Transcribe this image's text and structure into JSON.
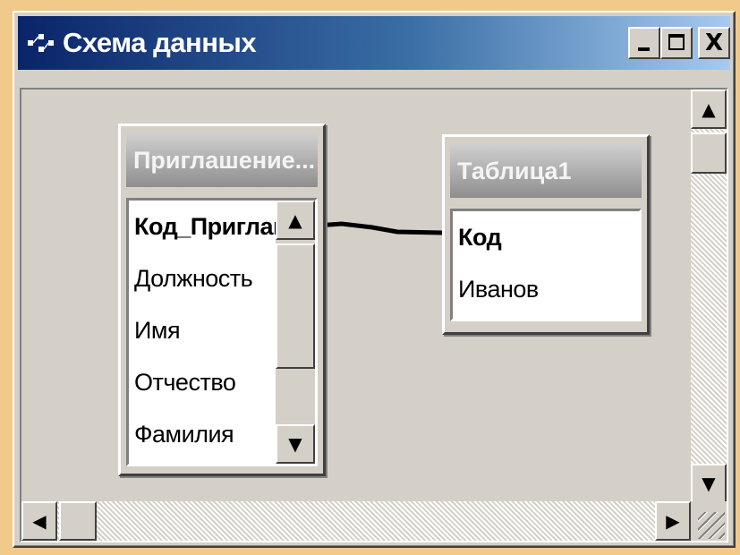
{
  "window": {
    "title": "Схема данных",
    "buttons": {
      "minimize": "_",
      "maximize": "",
      "close": "X"
    }
  },
  "tables": [
    {
      "name": "Приглашение...",
      "fields": [
        "Код_Приглаш",
        "Должность",
        "Имя",
        "Отчество",
        "Фамилия"
      ],
      "primary_key": "Код_Приглаш"
    },
    {
      "name": "Таблица1",
      "fields": [
        "Код",
        "Иванов"
      ],
      "primary_key": "Код"
    }
  ],
  "scrollbar_glyphs": {
    "up": "▲",
    "down": "▼",
    "left": "◀",
    "right": "▶"
  },
  "colors": {
    "titlebar_start": "#0a246a",
    "titlebar_end": "#a6caf0",
    "window_face": "#d4d0c8",
    "background": "#f1c98a"
  }
}
